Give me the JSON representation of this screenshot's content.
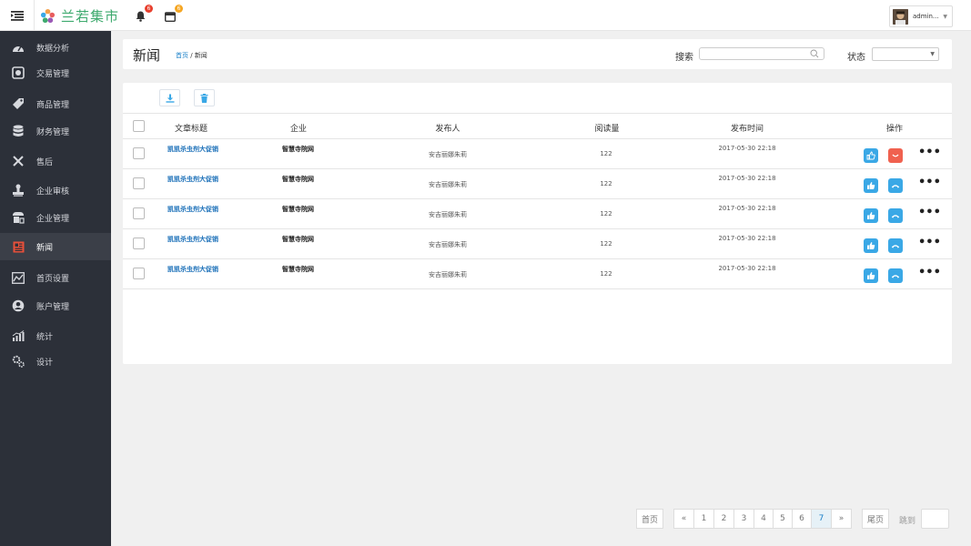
{
  "app": {
    "brand": "兰若集市",
    "notifications_count": "6",
    "messages_count": "6",
    "user_name": "admin..."
  },
  "sidebar": {
    "items": [
      {
        "label": "数据分析",
        "icon": "dashboard-icon"
      },
      {
        "label": "交易管理",
        "icon": "transaction-icon"
      },
      {
        "label": "商品管理",
        "icon": "tag-icon"
      },
      {
        "label": "财务管理",
        "icon": "database-icon"
      },
      {
        "label": "售后",
        "icon": "tools-icon"
      },
      {
        "label": "企业审核",
        "icon": "stamp-icon"
      },
      {
        "label": "企业管理",
        "icon": "store-icon"
      },
      {
        "label": "新闻",
        "icon": "news-icon",
        "active": true
      },
      {
        "label": "首页设置",
        "icon": "homepage-settings-icon"
      },
      {
        "label": "账户管理",
        "icon": "account-icon"
      },
      {
        "label": "统计",
        "icon": "chart-icon"
      },
      {
        "label": "设计",
        "icon": "gears-icon"
      }
    ]
  },
  "header": {
    "title": "新闻",
    "breadcrumb_home": "首页",
    "breadcrumb_sep": " / ",
    "breadcrumb_current": "新闻",
    "search_label": "搜索",
    "search_value": "",
    "status_label": "状态",
    "status_value": ""
  },
  "table": {
    "columns": {
      "title": "文章标题",
      "enterprise": "企业",
      "publisher": "发布人",
      "reads": "阅读量",
      "time": "发布时间",
      "actions": "操作"
    },
    "rows": [
      {
        "title": "凯凯杀虫剂大促销",
        "enterprise": "智慧寺院网",
        "publisher": "安吉丽娜朱莉",
        "reads": "122",
        "time": "2017-05-30 22:18",
        "second_action": "dislike"
      },
      {
        "title": "凯凯杀虫剂大促销",
        "enterprise": "智慧寺院网",
        "publisher": "安吉丽娜朱莉",
        "reads": "122",
        "time": "2017-05-30 22:18",
        "second_action": "hangup"
      },
      {
        "title": "凯凯杀虫剂大促销",
        "enterprise": "智慧寺院网",
        "publisher": "安吉丽娜朱莉",
        "reads": "122",
        "time": "2017-05-30 22:18",
        "second_action": "hangup"
      },
      {
        "title": "凯凯杀虫剂大促销",
        "enterprise": "智慧寺院网",
        "publisher": "安吉丽娜朱莉",
        "reads": "122",
        "time": "2017-05-30 22:18",
        "second_action": "hangup"
      },
      {
        "title": "凯凯杀虫剂大促销",
        "enterprise": "智慧寺院网",
        "publisher": "安吉丽娜朱莉",
        "reads": "122",
        "time": "2017-05-30 22:18",
        "second_action": "hangup"
      }
    ]
  },
  "pagination": {
    "first": "首页",
    "prev": "«",
    "pages": [
      "1",
      "2",
      "3",
      "4",
      "5",
      "6",
      "7"
    ],
    "current": "7",
    "next": "»",
    "last": "尾页",
    "jump_label": "跳到",
    "jump_value": ""
  },
  "colors": {
    "sidebar_bg": "#2c3039",
    "sidebar_active": "#3b3f48",
    "accent_blue": "#3aa8e6",
    "accent_red": "#f0614f",
    "brand_green": "#3eaa6e",
    "badge_red": "#e8402e",
    "badge_orange": "#f5a623"
  }
}
